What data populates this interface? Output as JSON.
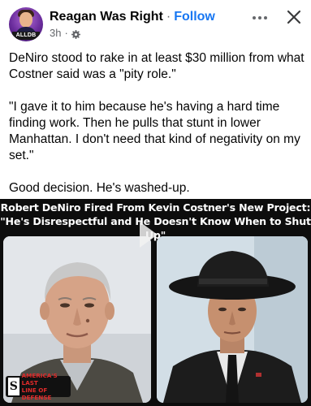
{
  "post": {
    "author": "Reagan Was Right",
    "separator": "·",
    "follow_label": "Follow",
    "timestamp": "3h",
    "meta_separator": "·",
    "privacy_icon": "gear-icon",
    "avatar_badge": "ALLDB",
    "more_icon": "more-dots-icon",
    "close_icon": "close-icon",
    "paragraphs": [
      "DeNiro stood to rake in at least $30 million from what Costner said was a \"pity role.\"",
      "\"I gave it to him because he's having a hard time finding work. Then he pulls that stunt in lower Manhattan. I don't need that kind of negativity on my set.\"",
      "Good decision. He's washed-up."
    ]
  },
  "media": {
    "headline_line1": "Robert DeNiro Fired From Kevin Costner's New Project:",
    "headline_line2": "\"He's Disrespectful and He Doesn't Know When to Shut Up\"",
    "left_photo": "older-man-portrait",
    "right_photo": "man-in-cowboy-hat-portrait",
    "watermark_letter": "S",
    "watermark_line1": "AMERICA'S LAST",
    "watermark_line2": "LINE OF DEFENSE"
  },
  "colors": {
    "link_blue": "#1877f2",
    "secondary_text": "#65676b",
    "media_background": "#0d0d0d",
    "watermark_red": "#e02a2a"
  }
}
